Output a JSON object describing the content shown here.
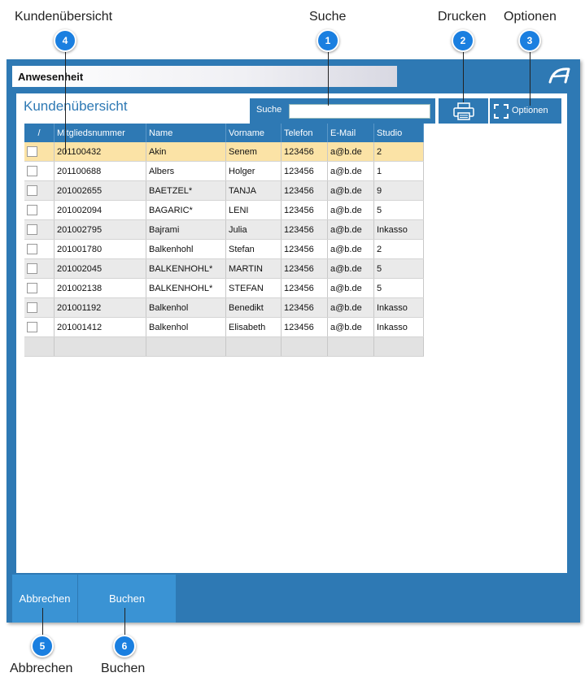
{
  "callouts": {
    "search": {
      "number": "1",
      "label": "Suche"
    },
    "print": {
      "number": "2",
      "label": "Drucken"
    },
    "options": {
      "number": "3",
      "label": "Optionen"
    },
    "overview": {
      "number": "4",
      "label": "Kundenübersicht"
    },
    "cancel": {
      "number": "5",
      "label": "Abbrechen"
    },
    "book": {
      "number": "6",
      "label": "Buchen"
    }
  },
  "window": {
    "title": "Anwesenheit",
    "logo_icon": "brand-logo-icon"
  },
  "panel": {
    "title": "Kundenübersicht",
    "search": {
      "label": "Suche",
      "value": "",
      "placeholder": ""
    },
    "print_icon": "printer-icon",
    "options": {
      "label": "Optionen",
      "icon": "expand-icon"
    }
  },
  "table": {
    "columns": [
      "/",
      "Mitgliedsnummer",
      "Name",
      "Vorname",
      "Telefon",
      "E-Mail",
      "Studio"
    ],
    "rows": [
      {
        "member": "201100432",
        "name": "Akin",
        "first": "Senem",
        "phone": "123456",
        "email": "a@b.de",
        "studio": "2"
      },
      {
        "member": "201100688",
        "name": "Albers",
        "first": "Holger",
        "phone": "123456",
        "email": "a@b.de",
        "studio": "1"
      },
      {
        "member": "201002655",
        "name": "BAETZEL*",
        "first": "TANJA",
        "phone": "123456",
        "email": "a@b.de",
        "studio": "9"
      },
      {
        "member": "201002094",
        "name": "BAGARIC*",
        "first": "LENI",
        "phone": "123456",
        "email": "a@b.de",
        "studio": "5"
      },
      {
        "member": "201002795",
        "name": "Bajrami",
        "first": "Julia",
        "phone": "123456",
        "email": "a@b.de",
        "studio": "Inkasso"
      },
      {
        "member": "201001780",
        "name": "Balkenhohl",
        "first": "Stefan",
        "phone": "123456",
        "email": "a@b.de",
        "studio": "2"
      },
      {
        "member": "201002045",
        "name": "BALKENHOHL*",
        "first": "MARTIN",
        "phone": "123456",
        "email": "a@b.de",
        "studio": "5"
      },
      {
        "member": "201002138",
        "name": "BALKENHOHL*",
        "first": "STEFAN",
        "phone": "123456",
        "email": "a@b.de",
        "studio": "5"
      },
      {
        "member": "201001192",
        "name": "Balkenhol",
        "first": "Benedikt",
        "phone": "123456",
        "email": "a@b.de",
        "studio": "Inkasso"
      },
      {
        "member": "201001412",
        "name": "Balkenhol",
        "first": "Elisabeth",
        "phone": "123456",
        "email": "a@b.de",
        "studio": "Inkasso"
      }
    ],
    "selected_row": 0
  },
  "footer": {
    "cancel_label": "Abbrechen",
    "book_label": "Buchen"
  },
  "colors": {
    "accent": "#2e79b4",
    "footer_button": "#3a93d4",
    "selected_row": "#fbe3a6",
    "callout_bubble": "#1a7fe0"
  }
}
